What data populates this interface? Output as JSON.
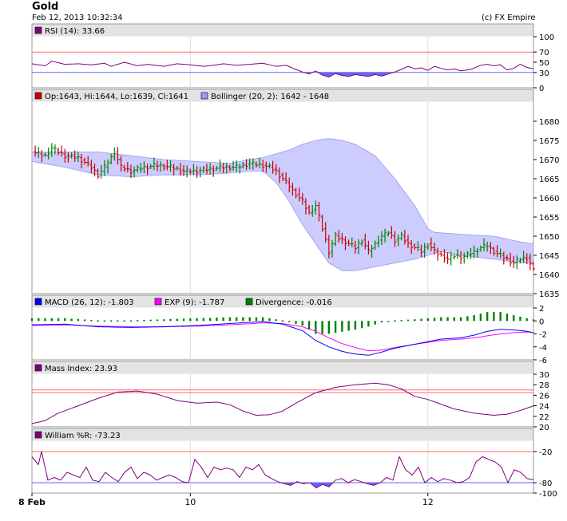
{
  "header": {
    "title": "Gold",
    "timestamp": "Feb 12, 2013 10:32:34",
    "copyright": "(c) FX Empire"
  },
  "x_axis": {
    "labels": [
      {
        "text": "8 Feb",
        "bar": 0,
        "bold": true
      },
      {
        "text": "10",
        "bar": 48,
        "bold": false
      },
      {
        "text": "12",
        "bar": 120,
        "bold": false
      }
    ]
  },
  "colors": {
    "bull": "#008000",
    "bear": "#cc0000",
    "band_fill": "#ccccff",
    "band_line": "#9999ee",
    "macd": "#0000ff",
    "exp": "#ff00ff",
    "divergence": "#008000",
    "indicator": "#800080",
    "level_red": "#ff6666",
    "level_blue": "#6666ff",
    "fill_below": "#6666ee"
  },
  "chart_data": [
    {
      "type": "line",
      "panel": "rsi",
      "legend": "RSI (14): 33.66",
      "legend_color": "#800080",
      "ylim": [
        0,
        100
      ],
      "yticks": [
        0,
        30,
        50,
        70,
        100
      ],
      "levels": [
        {
          "value": 70,
          "color": "red"
        },
        {
          "value": 30,
          "color": "blue"
        }
      ],
      "fill_below": 30,
      "anchors": [
        [
          0,
          47
        ],
        [
          4,
          43
        ],
        [
          6,
          52
        ],
        [
          10,
          46
        ],
        [
          14,
          47
        ],
        [
          18,
          45
        ],
        [
          22,
          48
        ],
        [
          24,
          42
        ],
        [
          26,
          46
        ],
        [
          28,
          50
        ],
        [
          32,
          43
        ],
        [
          35,
          46
        ],
        [
          40,
          42
        ],
        [
          44,
          47
        ],
        [
          48,
          45
        ],
        [
          52,
          42
        ],
        [
          55,
          44
        ],
        [
          58,
          47
        ],
        [
          62,
          44
        ],
        [
          66,
          46
        ],
        [
          70,
          48
        ],
        [
          74,
          42
        ],
        [
          77,
          44
        ],
        [
          80,
          36
        ],
        [
          82,
          31
        ],
        [
          84,
          27
        ],
        [
          86,
          33
        ],
        [
          88,
          25
        ],
        [
          90,
          21
        ],
        [
          92,
          28
        ],
        [
          94,
          24
        ],
        [
          96,
          22
        ],
        [
          98,
          26
        ],
        [
          100,
          24
        ],
        [
          102,
          22
        ],
        [
          104,
          26
        ],
        [
          106,
          23
        ],
        [
          108,
          27
        ],
        [
          110,
          31
        ],
        [
          112,
          36
        ],
        [
          114,
          42
        ],
        [
          116,
          37
        ],
        [
          118,
          39
        ],
        [
          120,
          34
        ],
        [
          122,
          42
        ],
        [
          124,
          38
        ],
        [
          126,
          35
        ],
        [
          128,
          37
        ],
        [
          130,
          33
        ],
        [
          133,
          36
        ],
        [
          136,
          44
        ],
        [
          138,
          46
        ],
        [
          140,
          43
        ],
        [
          142,
          45
        ],
        [
          144,
          35
        ],
        [
          146,
          38
        ],
        [
          148,
          46
        ],
        [
          150,
          40
        ],
        [
          152,
          37
        ]
      ]
    },
    {
      "type": "candlestick",
      "panel": "price",
      "legend": "Op:1643, Hi:1644, Lo:1639, Cl:1641",
      "legend_color": "#cc0000",
      "legend2": "Bollinger (20, 2): 1642 - 1648",
      "legend2_color": "#9999ff",
      "ylim": [
        1635,
        1685
      ],
      "yticks": [
        1635,
        1640,
        1645,
        1650,
        1655,
        1660,
        1665,
        1670,
        1675,
        1680
      ],
      "close_anchors": [
        [
          0,
          1672
        ],
        [
          4,
          1671
        ],
        [
          6,
          1673
        ],
        [
          10,
          1671
        ],
        [
          14,
          1670.5
        ],
        [
          18,
          1668
        ],
        [
          20,
          1666
        ],
        [
          22,
          1668
        ],
        [
          25,
          1672
        ],
        [
          27,
          1668
        ],
        [
          30,
          1667
        ],
        [
          34,
          1668
        ],
        [
          38,
          1668.5
        ],
        [
          42,
          1668
        ],
        [
          46,
          1667
        ],
        [
          50,
          1667
        ],
        [
          54,
          1667.5
        ],
        [
          58,
          1668
        ],
        [
          62,
          1668
        ],
        [
          66,
          1669
        ],
        [
          70,
          1668.5
        ],
        [
          72,
          1668
        ],
        [
          74,
          1667
        ],
        [
          76,
          1665
        ],
        [
          78,
          1663
        ],
        [
          80,
          1661
        ],
        [
          82,
          1659
        ],
        [
          84,
          1656
        ],
        [
          86,
          1658
        ],
        [
          88,
          1652
        ],
        [
          90,
          1646
        ],
        [
          92,
          1650
        ],
        [
          94,
          1649
        ],
        [
          96,
          1648
        ],
        [
          98,
          1647
        ],
        [
          100,
          1649
        ],
        [
          102,
          1646
        ],
        [
          104,
          1648
        ],
        [
          106,
          1650
        ],
        [
          108,
          1651
        ],
        [
          110,
          1649
        ],
        [
          112,
          1650
        ],
        [
          114,
          1648
        ],
        [
          116,
          1647
        ],
        [
          118,
          1646
        ],
        [
          120,
          1648
        ],
        [
          122,
          1646
        ],
        [
          124,
          1645
        ],
        [
          126,
          1644
        ],
        [
          128,
          1645
        ],
        [
          130,
          1644.5
        ],
        [
          132,
          1645
        ],
        [
          134,
          1646
        ],
        [
          136,
          1647
        ],
        [
          138,
          1647.5
        ],
        [
          140,
          1646
        ],
        [
          142,
          1645
        ],
        [
          144,
          1644
        ],
        [
          146,
          1643
        ],
        [
          148,
          1644
        ],
        [
          150,
          1644.5
        ],
        [
          152,
          1641
        ]
      ],
      "bollinger_upper_anchors": [
        [
          0,
          1672
        ],
        [
          10,
          1672
        ],
        [
          20,
          1672
        ],
        [
          30,
          1671
        ],
        [
          40,
          1670
        ],
        [
          50,
          1669.5
        ],
        [
          60,
          1669
        ],
        [
          66,
          1670
        ],
        [
          70,
          1670.5
        ],
        [
          74,
          1671.5
        ],
        [
          78,
          1672.5
        ],
        [
          82,
          1674
        ],
        [
          86,
          1675
        ],
        [
          90,
          1675.5
        ],
        [
          94,
          1675
        ],
        [
          98,
          1674
        ],
        [
          104,
          1671
        ],
        [
          110,
          1665
        ],
        [
          116,
          1658
        ],
        [
          120,
          1652
        ],
        [
          122,
          1651
        ],
        [
          130,
          1650.5
        ],
        [
          140,
          1650
        ],
        [
          148,
          1648.5
        ],
        [
          152,
          1648
        ]
      ],
      "bollinger_lower_anchors": [
        [
          0,
          1669.5
        ],
        [
          10,
          1668
        ],
        [
          20,
          1666
        ],
        [
          30,
          1665.5
        ],
        [
          40,
          1666
        ],
        [
          50,
          1666
        ],
        [
          60,
          1666.5
        ],
        [
          66,
          1667
        ],
        [
          70,
          1667
        ],
        [
          74,
          1664
        ],
        [
          78,
          1659
        ],
        [
          82,
          1653
        ],
        [
          86,
          1648
        ],
        [
          90,
          1643
        ],
        [
          94,
          1641
        ],
        [
          98,
          1641
        ],
        [
          104,
          1642
        ],
        [
          110,
          1643
        ],
        [
          116,
          1644
        ],
        [
          120,
          1645
        ],
        [
          124,
          1646
        ],
        [
          130,
          1645
        ],
        [
          140,
          1644
        ],
        [
          148,
          1643
        ],
        [
          152,
          1643
        ]
      ]
    },
    {
      "type": "bar+line",
      "panel": "macd",
      "legend_macd": "MACD (26, 12): -1.803",
      "legend_exp": "EXP (9): -1.787",
      "legend_div": "Divergence: -0.016",
      "ylim": [
        -6,
        2
      ],
      "yticks": [
        -6,
        -4,
        -2,
        0,
        2
      ],
      "macd_anchors": [
        [
          0,
          -0.6
        ],
        [
          10,
          -0.5
        ],
        [
          20,
          -0.9
        ],
        [
          30,
          -1.0
        ],
        [
          40,
          -0.9
        ],
        [
          50,
          -0.7
        ],
        [
          60,
          -0.4
        ],
        [
          70,
          -0.1
        ],
        [
          76,
          -0.5
        ],
        [
          82,
          -1.5
        ],
        [
          86,
          -3.0
        ],
        [
          90,
          -4.0
        ],
        [
          94,
          -4.7
        ],
        [
          98,
          -5.1
        ],
        [
          102,
          -5.3
        ],
        [
          106,
          -4.8
        ],
        [
          110,
          -4.2
        ],
        [
          116,
          -3.6
        ],
        [
          120,
          -3.2
        ],
        [
          124,
          -2.8
        ],
        [
          130,
          -2.6
        ],
        [
          134,
          -2.2
        ],
        [
          138,
          -1.6
        ],
        [
          142,
          -1.3
        ],
        [
          146,
          -1.4
        ],
        [
          150,
          -1.6
        ],
        [
          152,
          -1.8
        ]
      ],
      "exp_anchors": [
        [
          0,
          -0.7
        ],
        [
          10,
          -0.6
        ],
        [
          20,
          -0.8
        ],
        [
          30,
          -0.9
        ],
        [
          40,
          -0.9
        ],
        [
          50,
          -0.8
        ],
        [
          60,
          -0.6
        ],
        [
          70,
          -0.3
        ],
        [
          76,
          -0.4
        ],
        [
          82,
          -0.9
        ],
        [
          86,
          -1.6
        ],
        [
          90,
          -2.6
        ],
        [
          94,
          -3.5
        ],
        [
          98,
          -4.1
        ],
        [
          102,
          -4.6
        ],
        [
          106,
          -4.5
        ],
        [
          110,
          -4.1
        ],
        [
          116,
          -3.6
        ],
        [
          120,
          -3.3
        ],
        [
          124,
          -3.0
        ],
        [
          130,
          -2.8
        ],
        [
          134,
          -2.6
        ],
        [
          138,
          -2.3
        ],
        [
          142,
          -2.0
        ],
        [
          146,
          -1.8
        ],
        [
          150,
          -1.7
        ],
        [
          152,
          -1.79
        ]
      ]
    },
    {
      "type": "line",
      "panel": "mass",
      "legend": "Mass Index: 23.93",
      "legend_color": "#800080",
      "ylim": [
        20,
        30
      ],
      "yticks": [
        20,
        22,
        24,
        26,
        28,
        30
      ],
      "levels": [
        {
          "value": 27,
          "color": "red"
        },
        {
          "value": 26.5,
          "color": "red"
        }
      ],
      "anchors": [
        [
          0,
          20.6
        ],
        [
          4,
          21.2
        ],
        [
          8,
          22.6
        ],
        [
          14,
          24
        ],
        [
          20,
          25.4
        ],
        [
          26,
          26.6
        ],
        [
          32,
          26.8
        ],
        [
          38,
          26.2
        ],
        [
          44,
          25.0
        ],
        [
          50,
          24.5
        ],
        [
          56,
          24.7
        ],
        [
          60,
          24.2
        ],
        [
          64,
          23.0
        ],
        [
          68,
          22.2
        ],
        [
          72,
          22.3
        ],
        [
          76,
          23.0
        ],
        [
          80,
          24.5
        ],
        [
          86,
          26.5
        ],
        [
          92,
          27.5
        ],
        [
          98,
          28.0
        ],
        [
          104,
          28.3
        ],
        [
          108,
          28.0
        ],
        [
          112,
          27.2
        ],
        [
          116,
          25.8
        ],
        [
          120,
          25.2
        ],
        [
          124,
          24.3
        ],
        [
          128,
          23.4
        ],
        [
          134,
          22.6
        ],
        [
          140,
          22.2
        ],
        [
          144,
          22.4
        ],
        [
          148,
          23.1
        ],
        [
          152,
          24.0
        ]
      ]
    },
    {
      "type": "line",
      "panel": "williams",
      "legend": "William %R: -73.23",
      "legend_color": "#800080",
      "ylim": [
        -100,
        0
      ],
      "yticks": [
        -100,
        -80,
        -20
      ],
      "levels": [
        {
          "value": -20,
          "color": "red"
        },
        {
          "value": -80,
          "color": "blue"
        }
      ],
      "fill_below": -80,
      "anchors": [
        [
          0,
          -30
        ],
        [
          2,
          -45
        ],
        [
          3,
          -20
        ],
        [
          5,
          -75
        ],
        [
          7,
          -70
        ],
        [
          9,
          -75
        ],
        [
          11,
          -60
        ],
        [
          13,
          -65
        ],
        [
          15,
          -70
        ],
        [
          17,
          -50
        ],
        [
          19,
          -75
        ],
        [
          21,
          -78
        ],
        [
          23,
          -60
        ],
        [
          25,
          -70
        ],
        [
          27,
          -78
        ],
        [
          29,
          -60
        ],
        [
          31,
          -50
        ],
        [
          33,
          -72
        ],
        [
          35,
          -60
        ],
        [
          37,
          -65
        ],
        [
          39,
          -75
        ],
        [
          41,
          -70
        ],
        [
          43,
          -65
        ],
        [
          45,
          -70
        ],
        [
          47,
          -78
        ],
        [
          49,
          -80
        ],
        [
          51,
          -35
        ],
        [
          53,
          -50
        ],
        [
          55,
          -70
        ],
        [
          57,
          -50
        ],
        [
          59,
          -55
        ],
        [
          61,
          -52
        ],
        [
          63,
          -55
        ],
        [
          65,
          -70
        ],
        [
          67,
          -50
        ],
        [
          69,
          -55
        ],
        [
          71,
          -45
        ],
        [
          73,
          -65
        ],
        [
          75,
          -72
        ],
        [
          77,
          -78
        ],
        [
          79,
          -82
        ],
        [
          81,
          -85
        ],
        [
          83,
          -78
        ],
        [
          85,
          -82
        ],
        [
          87,
          -80
        ],
        [
          89,
          -90
        ],
        [
          91,
          -83
        ],
        [
          93,
          -88
        ],
        [
          95,
          -75
        ],
        [
          97,
          -72
        ],
        [
          99,
          -80
        ],
        [
          101,
          -74
        ],
        [
          103,
          -78
        ],
        [
          105,
          -82
        ],
        [
          107,
          -85
        ],
        [
          109,
          -80
        ],
        [
          111,
          -70
        ],
        [
          113,
          -75
        ],
        [
          115,
          -30
        ],
        [
          117,
          -55
        ],
        [
          119,
          -65
        ],
        [
          121,
          -50
        ],
        [
          123,
          -80
        ],
        [
          125,
          -70
        ],
        [
          127,
          -78
        ],
        [
          129,
          -72
        ],
        [
          131,
          -75
        ],
        [
          133,
          -80
        ],
        [
          135,
          -78
        ],
        [
          137,
          -70
        ],
        [
          139,
          -40
        ],
        [
          141,
          -30
        ],
        [
          143,
          -35
        ],
        [
          145,
          -40
        ],
        [
          147,
          -50
        ],
        [
          149,
          -80
        ],
        [
          151,
          -55
        ],
        [
          153,
          -60
        ],
        [
          155,
          -72
        ],
        [
          157,
          -74
        ]
      ]
    }
  ]
}
